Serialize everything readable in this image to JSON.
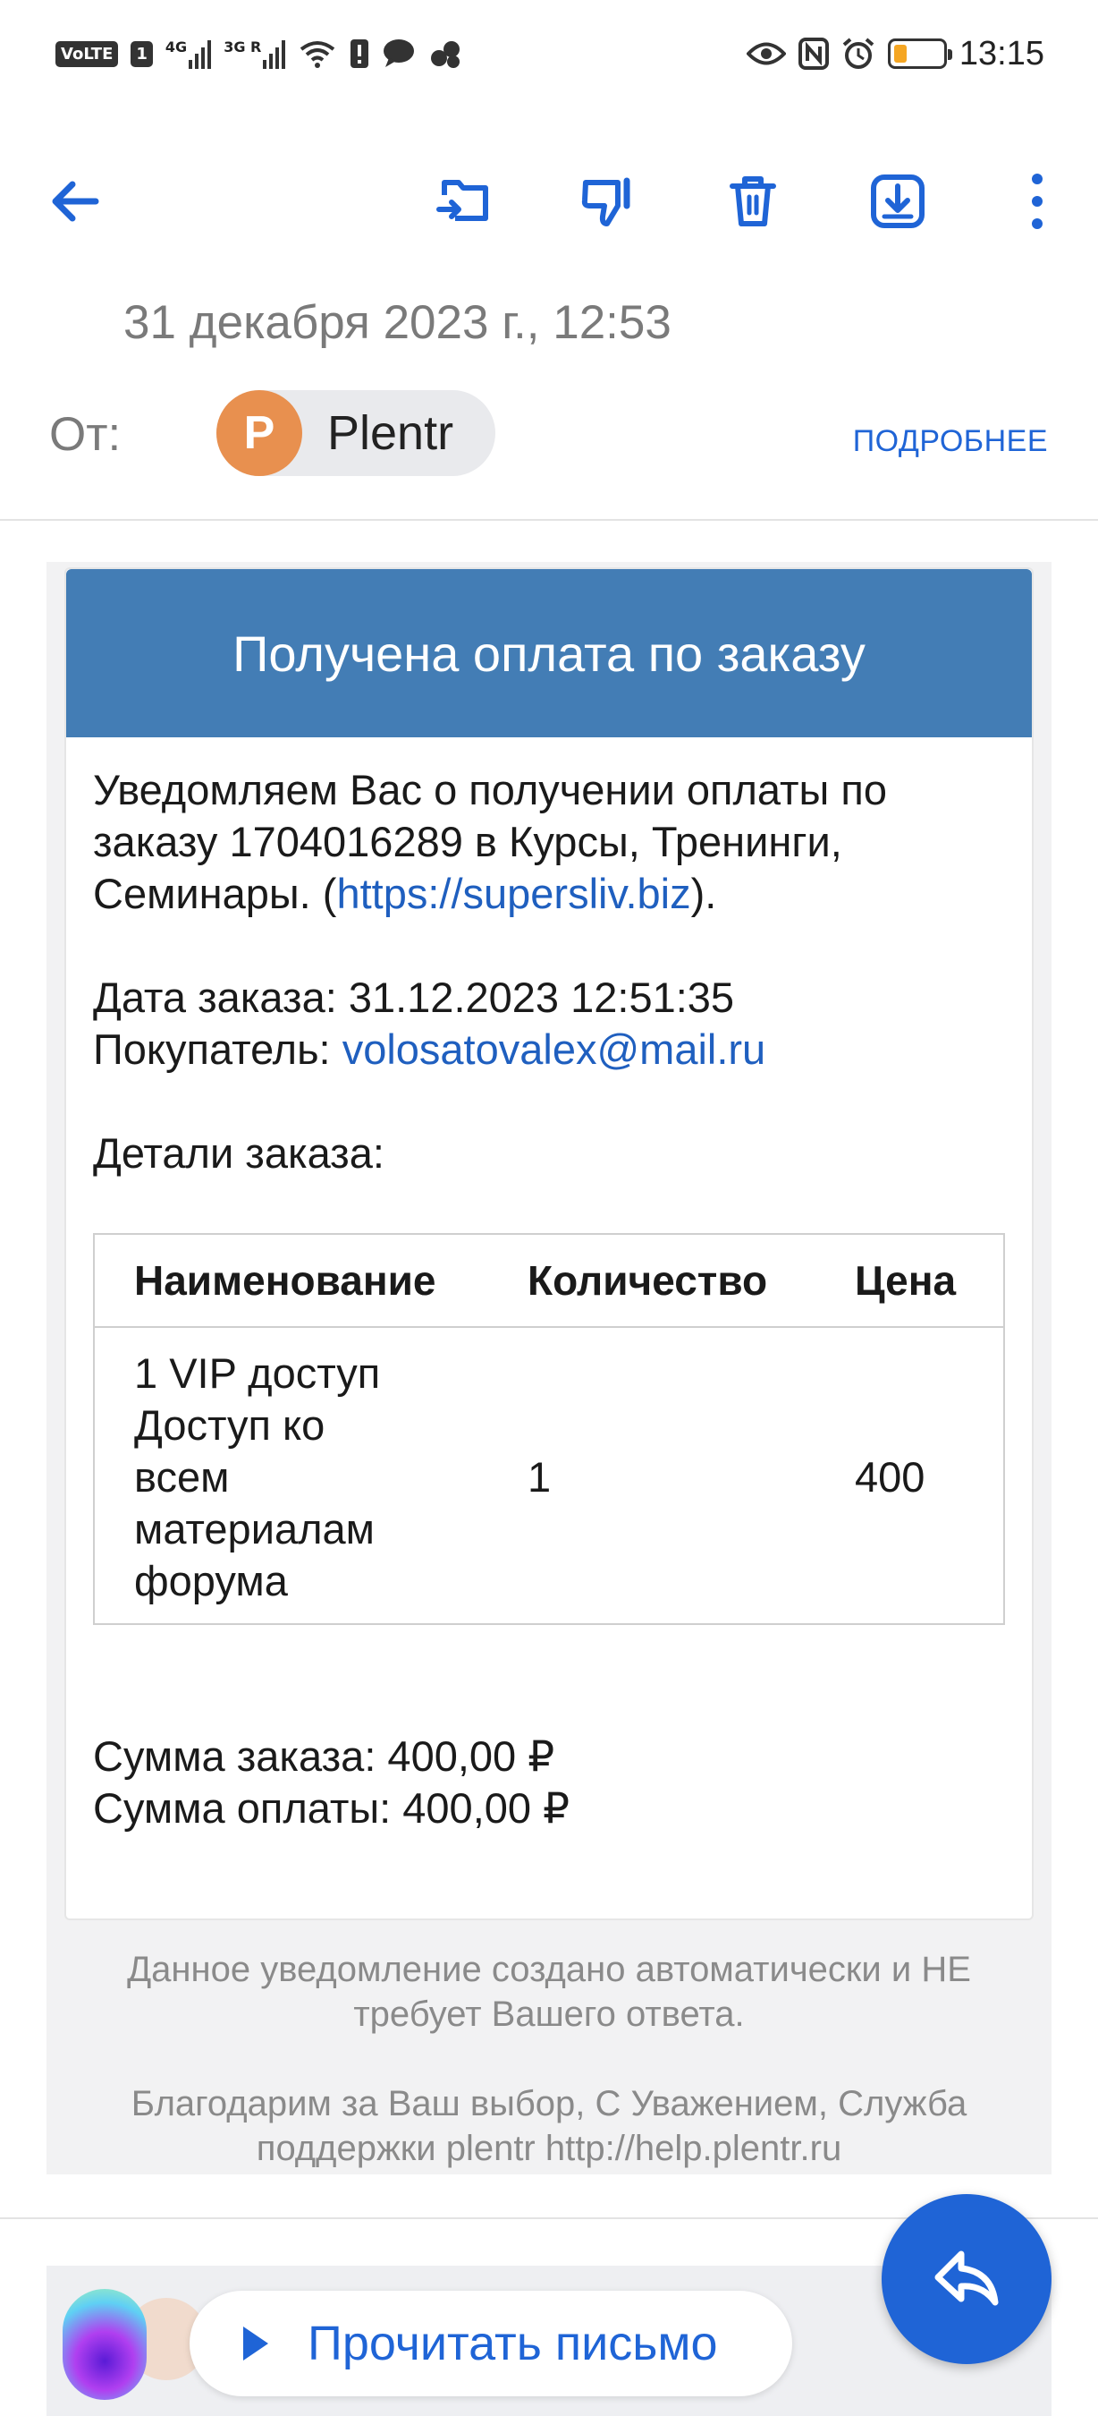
{
  "status_bar": {
    "left_badges": [
      "VoLTE",
      "1"
    ],
    "network_1": "4G",
    "network_2": "3G R",
    "time": "13:15",
    "icons": [
      "wifi-icon",
      "sim-alert-icon",
      "message-icon",
      "dots-app-icon",
      "eye-icon",
      "nfc-icon",
      "alarm-icon",
      "battery-icon"
    ],
    "battery_level_percent": 15,
    "battery_color": "#f5a623"
  },
  "toolbar": {
    "icons": [
      "back-arrow-icon",
      "move-to-folder-icon",
      "spam-thumb-down-icon",
      "trash-icon",
      "download-icon",
      "more-vert-icon"
    ],
    "accent_color": "#1f64d6"
  },
  "header": {
    "date": "31 декабря 2023 г., 12:53",
    "from_label": "От:",
    "sender_initial": "P",
    "sender_name": "Plentr",
    "more_link": "ПОДРОБНЕЕ"
  },
  "email": {
    "title": "Получена оплата по заказу",
    "header_color": "#437db5",
    "intro_part1": "Уведомляем Вас о получении оплаты по заказу 1704016289 в Курсы, Тренинги, Семинары. (",
    "intro_link": "https://supersliv.biz",
    "intro_part2": ").",
    "order_date_label": "Дата заказа: 31.12.2023 12:51:35",
    "buyer_label": "Покупатель: ",
    "buyer_email": "volosatovalex@mail.ru",
    "details_label": "Детали заказа:",
    "table": {
      "headers": [
        "Наименование",
        "Количество",
        "Цена"
      ],
      "rows": [
        {
          "name": "1 VIP доступ Доступ ко всем материалам форума",
          "qty": "1",
          "price": "400"
        }
      ]
    },
    "order_sum": "Сумма заказа: 400,00 ₽",
    "paid_sum": "Сумма оплаты: 400,00 ₽",
    "footer_note_1": "Данное уведомление создано автоматически и НЕ требует Вашего ответа.",
    "footer_note_2": "Благодарим за Ваш выбор, С Уважением, Служба поддержки plentr http://help.plentr.ru"
  },
  "bottom": {
    "read_button": "Прочитать письмо",
    "reply_icon": "reply-icon"
  }
}
